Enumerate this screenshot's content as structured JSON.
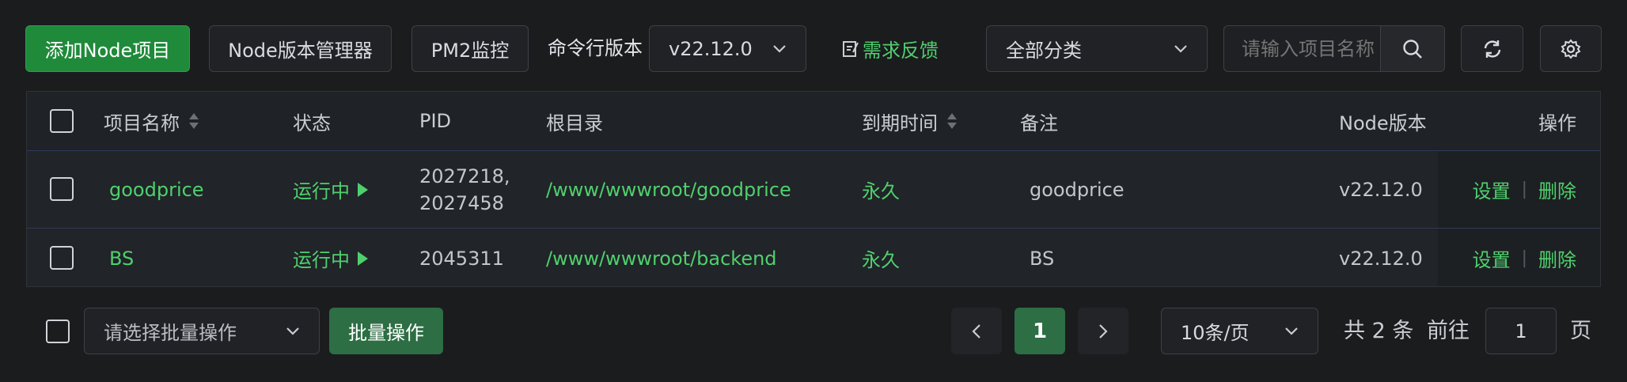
{
  "toolbar": {
    "add_node_project": "添加Node项目",
    "node_version_manager": "Node版本管理器",
    "pm2_monitor": "PM2监控",
    "cli_version_label": "命令行版本",
    "cli_version_value": "v22.12.0",
    "feedback": "需求反馈",
    "category_value": "全部分类",
    "search_placeholder": "请输入项目名称"
  },
  "table": {
    "headers": {
      "name": "项目名称",
      "status": "状态",
      "pid": "PID",
      "root": "根目录",
      "expire": "到期时间",
      "remark": "备注",
      "node_version": "Node版本",
      "actions": "操作"
    },
    "rows": [
      {
        "name": "goodprice",
        "status": "运行中",
        "pid_line1": "2027218,",
        "pid_line2": "2027458",
        "root": "/www/wwwroot/goodprice",
        "expire": "永久",
        "remark": "goodprice",
        "node_version": "v22.12.0",
        "settings": "设置",
        "separator": "|",
        "delete": "删除"
      },
      {
        "name": "BS",
        "status": "运行中",
        "pid_line1": "2045311",
        "pid_line2": "",
        "root": "/www/wwwroot/backend",
        "expire": "永久",
        "remark": "BS",
        "node_version": "v22.12.0",
        "settings": "设置",
        "separator": "|",
        "delete": "删除"
      }
    ]
  },
  "footer": {
    "batch_select_placeholder": "请选择批量操作",
    "batch_button": "批量操作",
    "current_page": "1",
    "page_size": "10条/页",
    "total": "共 2 条",
    "goto_label": "前往",
    "goto_value": "1",
    "page_suffix": "页"
  },
  "colors": {
    "accent_green": "#4fd06e",
    "primary_button": "#1f8a3a",
    "background": "#1b1c1e"
  },
  "icons": [
    "chevron-down-icon",
    "feedback-edit-icon",
    "search-icon",
    "refresh-icon",
    "gear-icon",
    "sort-icon",
    "play-icon",
    "chevron-left-icon",
    "chevron-right-icon"
  ]
}
